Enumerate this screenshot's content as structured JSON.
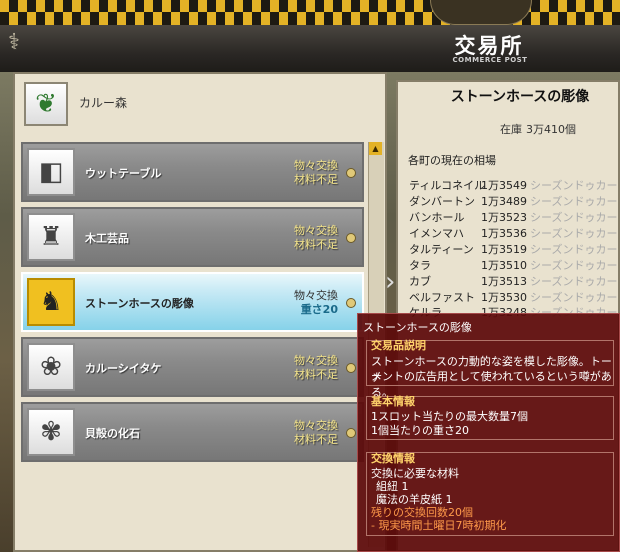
{
  "header": {
    "title": "交易所",
    "subtitle": "COMMERCE POST"
  },
  "location": {
    "name": "カルー森"
  },
  "items": [
    {
      "name": "ウットテーブル",
      "status1": "物々交換",
      "status2": "材料不足",
      "icon": "table-icon"
    },
    {
      "name": "木工芸品",
      "status1": "物々交換",
      "status2": "材料不足",
      "icon": "figurine-icon"
    },
    {
      "name": "ストーンホースの彫像",
      "status1": "物々交換",
      "status2": "重さ20",
      "icon": "horse-statue-icon"
    },
    {
      "name": "カルーシイタケ",
      "status1": "物々交換",
      "status2": "材料不足",
      "icon": "mushroom-icon"
    },
    {
      "name": "貝殻の化石",
      "status1": "物々交換",
      "status2": "材料不足",
      "icon": "shell-fossil-icon"
    }
  ],
  "detail": {
    "title": "ストーンホースの彫像",
    "stock_label": "在庫",
    "stock_value": "3万410個",
    "price_heading": "各町の現在の相場",
    "prices": [
      {
        "town": "ティルコネイル",
        "price": "1万3549",
        "route": "シーズンドゥカー"
      },
      {
        "town": "ダンバートン",
        "price": "1万3489",
        "route": "シーズンドゥカー"
      },
      {
        "town": "バンホール",
        "price": "1万3523",
        "route": "シーズンドゥカー"
      },
      {
        "town": "イメンマハ",
        "price": "1万3536",
        "route": "シーズンドゥカー"
      },
      {
        "town": "タルティーン",
        "price": "1万3519",
        "route": "シーズンドゥカー"
      },
      {
        "town": "タラ",
        "price": "1万3510",
        "route": "シーズンドゥカー"
      },
      {
        "town": "カブ",
        "price": "1万3513",
        "route": "シーズンドゥカー"
      },
      {
        "town": "ベルファスト",
        "price": "1万3530",
        "route": "シーズンドゥカー"
      },
      {
        "town": "ケルラ",
        "price": "1万3248",
        "route": "シーズンドゥカー"
      }
    ]
  },
  "tooltip": {
    "title": "ストーンホースの彫像",
    "desc_head": "交易品説明",
    "desc_line1": "ストーンホースの力動的な姿を模した彫像。トーナ",
    "desc_line2": "メントの広告用として使われているという噂がある。",
    "basic_head": "基本情報",
    "basic_line1": "1スロット当たりの最大数量7個",
    "basic_line2": "1個当たりの重さ20",
    "exchange_head": "交換情報",
    "exchange_line1": "交換に必要な材料",
    "exchange_line2": "組紐 1",
    "exchange_line3": "魔法の羊皮紙 1",
    "exchange_line4": "残りの交換回数20個",
    "exchange_line5": "- 現実時間土曜日7時初期化"
  }
}
